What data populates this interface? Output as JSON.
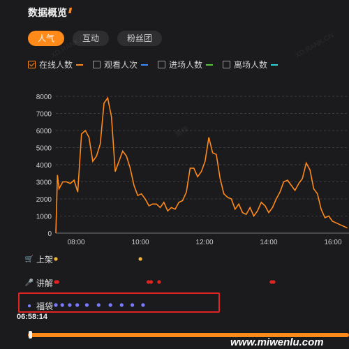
{
  "header": {
    "title": "数据概览"
  },
  "tabs": [
    {
      "label": "人气",
      "active": true
    },
    {
      "label": "互动",
      "active": false
    },
    {
      "label": "粉丝团",
      "active": false
    }
  ],
  "legend": [
    {
      "label": "在线人数",
      "checked": true,
      "color": "#ff8a1a"
    },
    {
      "label": "观看人次",
      "checked": false,
      "color": "#3d8bff"
    },
    {
      "label": "进场人数",
      "checked": false,
      "color": "#58c23a"
    },
    {
      "label": "离场人数",
      "checked": false,
      "color": "#2fd3d3"
    }
  ],
  "chart_data": {
    "type": "line",
    "series": [
      {
        "name": "在线人数",
        "color": "#ff8a1a",
        "x": [
          "07:22",
          "07:25",
          "07:28",
          "07:35",
          "07:42",
          "07:49",
          "07:56",
          "08:03",
          "08:10",
          "08:17",
          "08:24",
          "08:31",
          "08:38",
          "08:45",
          "08:52",
          "08:59",
          "09:06",
          "09:13",
          "09:20",
          "09:27",
          "09:34",
          "09:41",
          "09:48",
          "09:55",
          "10:02",
          "10:09",
          "10:16",
          "10:23",
          "10:30",
          "10:37",
          "10:44",
          "10:51",
          "10:58",
          "11:05",
          "11:12",
          "11:19",
          "11:26",
          "11:33",
          "11:40",
          "11:47",
          "11:54",
          "12:01",
          "12:08",
          "12:15",
          "12:22",
          "12:29",
          "12:36",
          "12:43",
          "12:50",
          "12:57",
          "13:04",
          "13:11",
          "13:18",
          "13:25",
          "13:32",
          "13:39",
          "13:46",
          "13:53",
          "14:00",
          "14:07",
          "14:14",
          "14:21",
          "14:28",
          "14:35",
          "14:42",
          "14:49",
          "14:56",
          "15:03",
          "15:10",
          "15:17",
          "15:24",
          "15:31",
          "15:38",
          "15:45",
          "15:52",
          "15:59",
          "16:06",
          "16:13",
          "16:20",
          "16:27"
        ],
        "y": [
          0,
          3400,
          2600,
          3000,
          3000,
          2900,
          3100,
          2400,
          5800,
          6000,
          5600,
          4200,
          4500,
          5200,
          7600,
          7900,
          6800,
          3600,
          4200,
          4800,
          4500,
          3800,
          2800,
          2200,
          2300,
          2000,
          1600,
          1700,
          1700,
          1500,
          1800,
          1300,
          1500,
          1400,
          1800,
          1900,
          2400,
          3800,
          3800,
          3300,
          3600,
          4200,
          5600,
          4700,
          4600,
          3200,
          2300,
          2100,
          2000,
          1400,
          1700,
          1200,
          1100,
          1500,
          1000,
          1300,
          1800,
          1600,
          1200,
          1500,
          2000,
          2400,
          3000,
          3100,
          2800,
          2500,
          2900,
          3200,
          4100,
          3700,
          2600,
          2300,
          1400,
          900,
          1000,
          700,
          600,
          500,
          400,
          300
        ],
        "point_color": "#ff8a1a"
      }
    ],
    "x_ticks": [
      "08:00",
      "10:00",
      "12:00",
      "14:00",
      "16:00"
    ],
    "y_ticks": [
      "0",
      "1000",
      "2000",
      "3000",
      "4000",
      "5000",
      "6000",
      "7000",
      "8000"
    ],
    "ylim": [
      0,
      8000
    ],
    "grid": true
  },
  "events": [
    {
      "label": "上架",
      "icon": "cart-icon",
      "color": "#f2b53a",
      "points": [
        "07:22",
        "10:00"
      ]
    },
    {
      "label": "讲解",
      "icon": "mic-icon",
      "color": "#e02424",
      "points": [
        "07:22",
        "07:25",
        "10:15",
        "10:20",
        "10:35",
        "14:05",
        "14:09"
      ]
    },
    {
      "label": "福袋",
      "icon": "bag-icon",
      "color": "#7b7bff",
      "points": [
        "07:22",
        "07:34",
        "07:48",
        "08:02",
        "08:20",
        "08:42",
        "09:04",
        "09:25",
        "09:45",
        "10:05"
      ]
    }
  ],
  "timeline": {
    "current_time": "06:58:14"
  },
  "watermarks": [
    "XD.RANK.CN",
    "新榜",
    "XD.RANK.CN"
  ],
  "brand": "www.miwenlu.com"
}
